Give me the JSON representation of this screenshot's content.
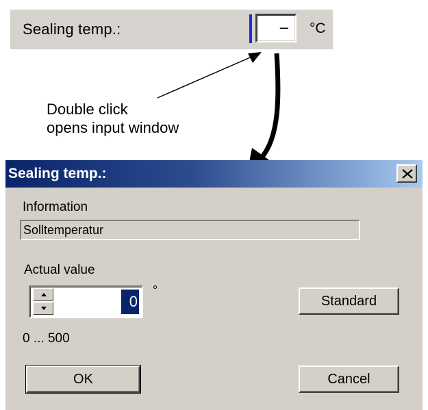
{
  "field": {
    "label": "Sealing temp.:",
    "value": "–",
    "unit": "°C"
  },
  "annotation": {
    "line1": "Double click",
    "line2": "opens input window"
  },
  "dialog": {
    "title": "Sealing temp.:",
    "close_icon": "close-icon",
    "information_label": "Information",
    "information_value": "Solltemperatur",
    "actual_value_label": "Actual value",
    "actual_value": "0",
    "unit": "°",
    "range": "0 ... 500",
    "buttons": {
      "standard": "Standard",
      "ok": "OK",
      "cancel": "Cancel"
    }
  },
  "colors": {
    "titlebar_start": "#0a246a",
    "titlebar_end": "#a6caf0",
    "dialog_bg": "#d4d0c8",
    "field_cursor": "#1f2bd8"
  }
}
